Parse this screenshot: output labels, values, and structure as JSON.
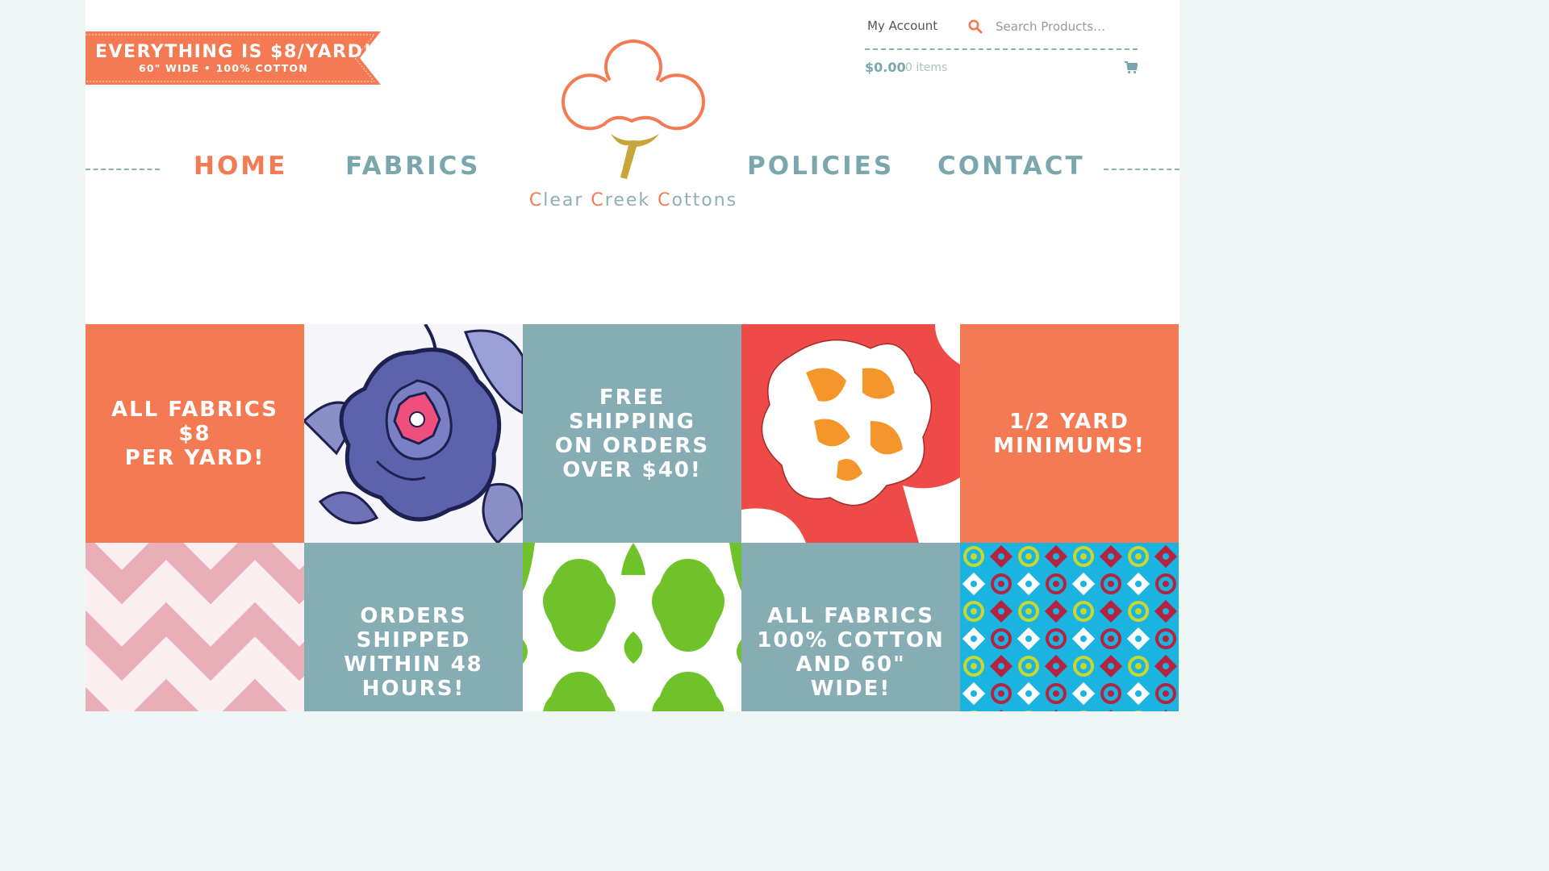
{
  "colors": {
    "coral": "#f37a52",
    "teal": "#86adb3",
    "page_bg": "#eff6f6",
    "nav_active": "#f37a52",
    "nav_default": "#7aa7ae"
  },
  "banner": {
    "line1": "EVERYTHING IS $8/YARD!",
    "line2": "60\" WIDE • 100% COTTON"
  },
  "header": {
    "my_account": "My Account",
    "search": {
      "placeholder": "Search Products…",
      "icon": "search-icon"
    },
    "cart": {
      "total": "$0.00",
      "items": "0 items",
      "icon": "cart-icon"
    }
  },
  "logo": {
    "name": "Clear Creek Cottons"
  },
  "nav": {
    "items": [
      {
        "label": "HOME",
        "active": true
      },
      {
        "label": "FABRICS",
        "active": false
      },
      {
        "label": "POLICIES",
        "active": false
      },
      {
        "label": "CONTACT",
        "active": false
      }
    ]
  },
  "tiles": [
    {
      "type": "text",
      "color": "coral",
      "text": "ALL FABRICS $8\nPER YARD!"
    },
    {
      "type": "image",
      "pattern": "navy floral fabric"
    },
    {
      "type": "text",
      "color": "teal",
      "text": "FREE SHIPPING\nON ORDERS\nOVER $40!"
    },
    {
      "type": "image",
      "pattern": "red orange floral fabric"
    },
    {
      "type": "text",
      "color": "coral",
      "text": "1/2 YARD\nMINIMUMS!"
    },
    {
      "type": "image",
      "pattern": "pink chevron fabric"
    },
    {
      "type": "text",
      "color": "teal",
      "text": "ORDERS\nSHIPPED\nWITHIN 48\nHOURS!"
    },
    {
      "type": "image",
      "pattern": "green quatrefoil fabric"
    },
    {
      "type": "text",
      "color": "teal",
      "text": "ALL FABRICS\n100% COTTON\nAND 60\" WIDE!"
    },
    {
      "type": "image",
      "pattern": "blue medallion fabric"
    }
  ]
}
